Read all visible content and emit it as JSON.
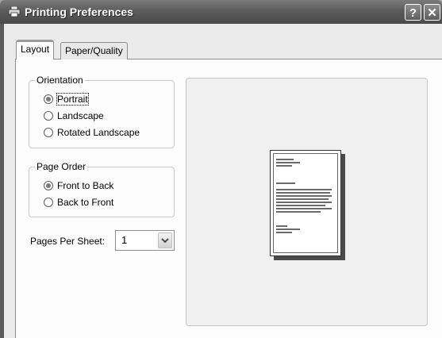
{
  "window": {
    "title": "Printing Preferences",
    "help_label": "?",
    "close_label": "✕"
  },
  "tabs": [
    {
      "label": "Layout",
      "active": true
    },
    {
      "label": "Paper/Quality",
      "active": false
    }
  ],
  "orientation": {
    "legend": "Orientation",
    "options": [
      {
        "label": "Portrait",
        "checked": true
      },
      {
        "label": "Landscape",
        "checked": false
      },
      {
        "label": "Rotated Landscape",
        "checked": false
      }
    ]
  },
  "page_order": {
    "legend": "Page Order",
    "options": [
      {
        "label": "Front to Back",
        "checked": true
      },
      {
        "label": "Back to Front",
        "checked": false
      }
    ]
  },
  "pages_per_sheet": {
    "label": "Pages Per Sheet:",
    "value": "1"
  },
  "icons": {
    "window": "printer-icon",
    "dropdown": "chevron-down-icon"
  }
}
